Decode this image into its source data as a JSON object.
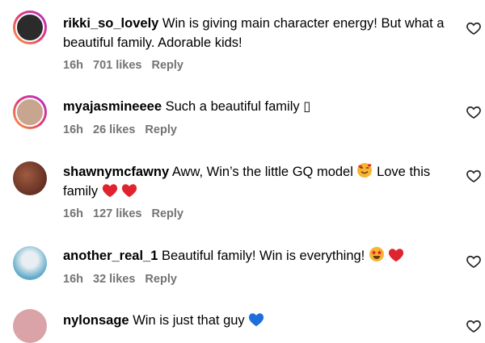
{
  "comments": [
    {
      "username": "rikki_so_lovely",
      "text": "Win is giving main character energy! But what a beautiful family. Adorable kids!",
      "time": "16h",
      "likes": "701 likes",
      "reply": "Reply",
      "avatar_ring": true,
      "avatar_color": "#2b2b2b"
    },
    {
      "username": "myajasmineeee",
      "text": "Such a beautiful family ▯",
      "time": "16h",
      "likes": "26 likes",
      "reply": "Reply",
      "avatar_ring": true,
      "avatar_color": "#c7a58e"
    },
    {
      "username": "shawnymcfawny",
      "text": "Aww, Win’s the little GQ model",
      "text_after": "Love this family",
      "time": "16h",
      "likes": "127 likes",
      "reply": "Reply",
      "avatar_ring": false,
      "avatar_color": "#7a3a2a",
      "emojis": [
        "smiling-face-with-hearts",
        "red-heart",
        "red-heart"
      ]
    },
    {
      "username": "another_real_1",
      "text": "Beautiful family! Win is everything!",
      "time": "16h",
      "likes": "32 likes",
      "reply": "Reply",
      "avatar_ring": false,
      "avatar_color": "#5fa9c9",
      "emojis": [
        "star-struck",
        "red-heart"
      ]
    },
    {
      "username": "nylonsage",
      "text": "Win is just that guy",
      "avatar_ring": false,
      "avatar_color": "#d9a3a8",
      "emojis": [
        "blue-heart"
      ]
    }
  ],
  "colors": {
    "meta_text": "#737373",
    "red_heart": "#e0242f",
    "blue_heart": "#1e6fd9"
  }
}
